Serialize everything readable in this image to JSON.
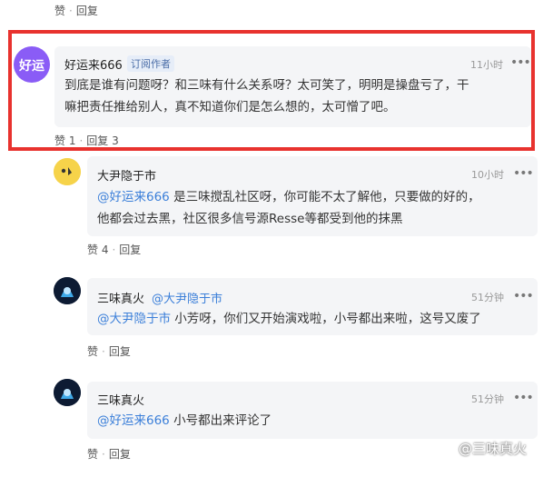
{
  "top_actions": {
    "like": "赞",
    "reply": "回复"
  },
  "main_comment": {
    "avatar_text": "好运",
    "name": "好运来666",
    "tag": "订阅作者",
    "time": "11小时",
    "text_line1": "到底是谁有问题呀？和三味有什么关系呀？太可笑了，明明是操盘亏了，干",
    "text_line2": "嘛把责任推给别人，真不知道你们是怎么想的，太可憎了吧。",
    "like": "赞 1",
    "reply": "回复 3"
  },
  "replies": [
    {
      "name": "大尹隐于市",
      "time": "10小时",
      "mention": "@好运来666",
      "text_line1": " 是三味搅乱社区呀，你可能不太了解他，只要做的好的，",
      "text_line2": "他都会过去黑，社区很多信号源Resse等都受到他的抹黑",
      "like": "赞 4",
      "reply": "回复"
    },
    {
      "name": "三味真火",
      "reply_to": "@大尹隐于市",
      "time": "51分钟",
      "mention": "@大尹隐于市",
      "text": " 小芳呀，你们又开始演戏啦，小号都出来啦，这号又废了",
      "like": "赞",
      "reply": "回复"
    },
    {
      "name": "三味真火",
      "time": "51分钟",
      "mention": "@好运来666",
      "text": " 小号都出来评论了",
      "like": "赞",
      "reply": "回复"
    }
  ],
  "more_icon": "more-dots-icon",
  "watermark": "@三味真火",
  "colors": {
    "highlight": "#e8322e",
    "mention": "#3b7fd9",
    "avatar_main": "#8a5cf6"
  }
}
